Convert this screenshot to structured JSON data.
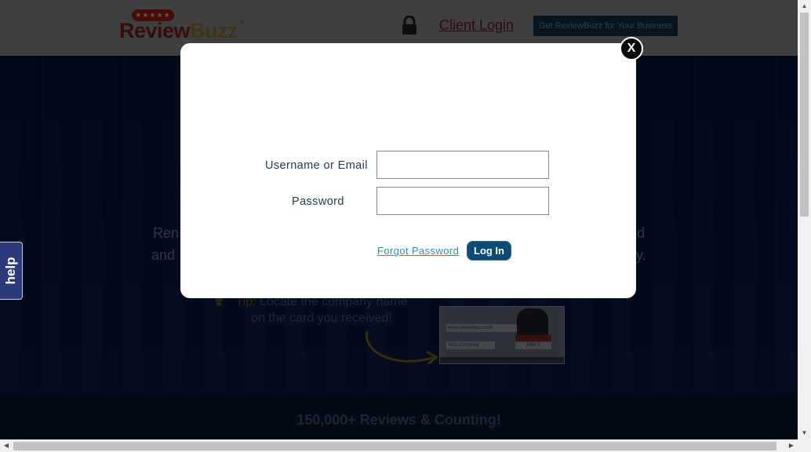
{
  "header": {
    "logo_stars": "★★★★★",
    "logo_review": "Review",
    "logo_buzz": "Buzz",
    "logo_reg": "®",
    "client_login": "Client Login",
    "get_button": "Get ReviewBuzz for Your Business"
  },
  "hero": {
    "line1_left": "Ren",
    "line1_right": "d",
    "line2_left": "and",
    "line2_right": "y.",
    "tip_label": "Tip:",
    "tip_text": " Locate the company name on the card you received!",
    "card_url": "www.reviewbuzz.com",
    "card_company": "ABC Company",
    "card_name": "John D",
    "counting": "150,000+ Reviews & Counting!"
  },
  "help_tab": {
    "label": "help"
  },
  "login_modal": {
    "close_label": "X",
    "username_label": "Username or Email",
    "username_value": "",
    "password_label": "Password",
    "password_value": "",
    "forgot_password": "Forgot Password",
    "login_button": "Log In"
  },
  "scrollbars": {
    "up_arrow": "▲",
    "down_arrow": "▼",
    "left_arrow": "◀",
    "right_arrow": "▶"
  },
  "colors": {
    "accent": "#0b4a72",
    "link": "#2f8fc8",
    "label": "#1c3a5a",
    "help_tab": "#2b3a7a"
  },
  "icons": [
    "lock-icon",
    "close-icon",
    "lightbulb-icon",
    "arrow-icon"
  ]
}
